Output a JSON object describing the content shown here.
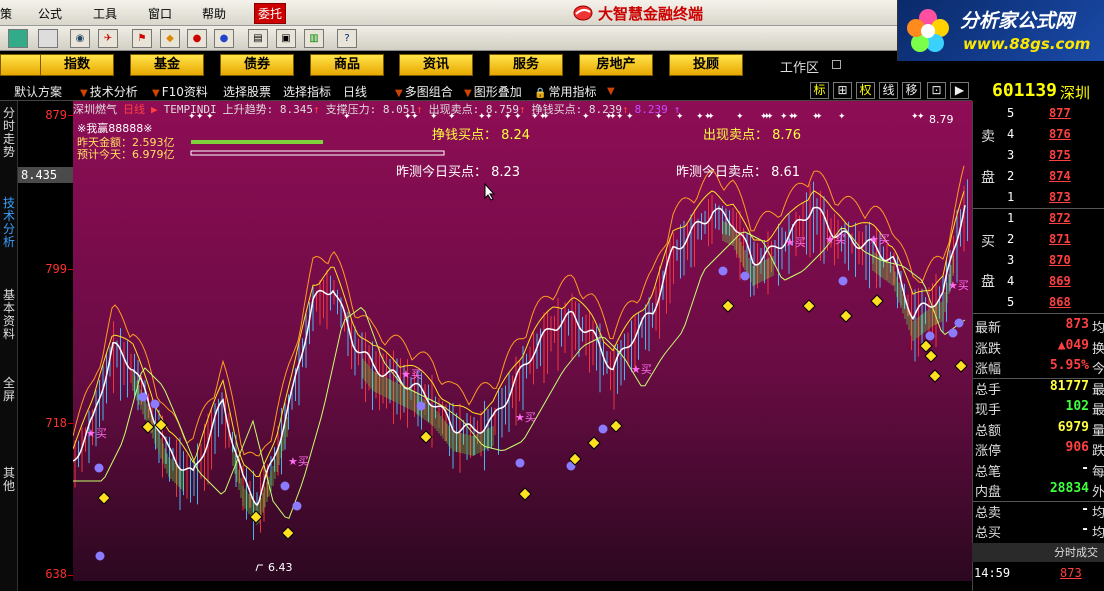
{
  "menu": {
    "items": [
      "策",
      "公式",
      "工具",
      "窗口",
      "帮助",
      "委托"
    ],
    "app_title": "大智慧金融终端"
  },
  "brand": {
    "name": "分析家公式网",
    "url": "www.88gs.com"
  },
  "categories": [
    "指数",
    "基金",
    "债券",
    "商品",
    "资讯",
    "服务",
    "房地产",
    "投顾"
  ],
  "workarea_label": "工作区",
  "indicator_bar": {
    "items": [
      "默认方案",
      "技术分析",
      "F10资料",
      "选择股票",
      "选择指标",
      "日线",
      "多图组合",
      "图形叠加",
      "常用指标"
    ],
    "right_buttons": [
      "标",
      "⊞",
      "权",
      "线",
      "移",
      "⊡",
      "▶"
    ]
  },
  "stock": {
    "code": "601139",
    "name": "深圳"
  },
  "left_tabs": [
    "分时走势",
    "技术分析",
    "基本资料",
    "全屏",
    "其他"
  ],
  "active_left_tab": "技术分析",
  "y_axis": {
    "labels": [
      "879",
      "799",
      "718",
      "638"
    ],
    "current": "8.435"
  },
  "chart_title": {
    "stock": "深圳燃气",
    "period": "日线",
    "indicator": "TEMPINDI",
    "fields": [
      {
        "label": "上升趋势",
        "value": "8.345"
      },
      {
        "label": "支撑压力",
        "value": "8.051"
      },
      {
        "label": "出现卖点",
        "value": "8.759"
      },
      {
        "label": "挣钱买点",
        "value": "8.239"
      }
    ],
    "extra": "8.239"
  },
  "chart_annotations": {
    "strategy": "※我赢88888※",
    "yesterday_amount": "昨天金额：2.593亿",
    "today_estimate": "预计今天：6.979亿",
    "buy_point": "挣钱买点： 8.24",
    "sell_point": "出现卖点： 8.76",
    "predict_buy": "昨测今日买点： 8.23",
    "predict_sell": "昨测今日卖点： 8.61",
    "low_label": "6.43",
    "high_label": "8.79",
    "buy_tag": "买"
  },
  "order_book": {
    "sell_label": [
      "卖",
      "盘"
    ],
    "buy_label": [
      "买",
      "盘"
    ],
    "sell": [
      {
        "i": "5",
        "p": "877"
      },
      {
        "i": "4",
        "p": "876"
      },
      {
        "i": "3",
        "p": "875"
      },
      {
        "i": "2",
        "p": "874"
      },
      {
        "i": "1",
        "p": "873"
      }
    ],
    "buy": [
      {
        "i": "1",
        "p": "872"
      },
      {
        "i": "2",
        "p": "871"
      },
      {
        "i": "3",
        "p": "870"
      },
      {
        "i": "4",
        "p": "869"
      },
      {
        "i": "5",
        "p": "868"
      }
    ]
  },
  "stats": [
    {
      "label": "最新",
      "value": "873",
      "tail": "均",
      "color": "#ff4040"
    },
    {
      "label": "涨跌",
      "value": "▲049",
      "tail": "换",
      "color": "#ff4040"
    },
    {
      "label": "涨幅",
      "value": "5.95%",
      "tail": "今",
      "color": "#ff4040"
    },
    {
      "label": "总手",
      "value": "81777",
      "tail": "最",
      "color": "#ffff40"
    },
    {
      "label": "现手",
      "value": "102",
      "tail": "最",
      "color": "#40ff40"
    },
    {
      "label": "总额",
      "value": "6979",
      "tail": "量",
      "color": "#ffff40"
    },
    {
      "label": "涨停",
      "value": "906",
      "tail": "跌",
      "color": "#ff4040"
    },
    {
      "label": "总笔",
      "value": "-",
      "tail": "每",
      "color": "#ffffff"
    },
    {
      "label": "内盘",
      "value": "28834",
      "tail": "外",
      "color": "#40ff40"
    },
    {
      "label": "总卖",
      "value": "-",
      "tail": "均",
      "color": "#ffffff"
    },
    {
      "label": "总买",
      "value": "-",
      "tail": "均",
      "color": "#ffffff"
    }
  ],
  "fenshi_label": "分时成交",
  "trade": {
    "time": "14:59",
    "price": "873"
  },
  "colors": {
    "chart_bg_top": "#9a0f58",
    "chart_bg_bottom": "#3a0a28",
    "accent": "#ffff00"
  }
}
